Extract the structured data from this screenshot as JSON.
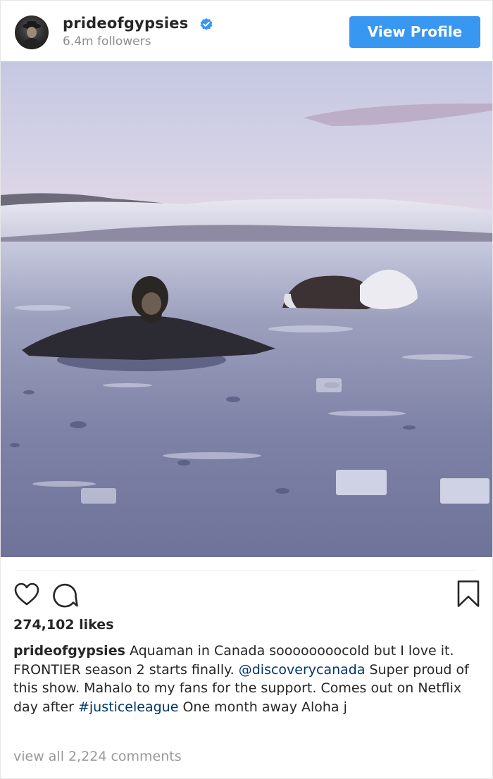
{
  "header": {
    "username": "prideofgypsies",
    "followers": "6.4m followers",
    "view_profile_label": "View Profile"
  },
  "icons": {
    "like": "heart-outline-icon",
    "comment": "speech-bubble-icon",
    "save": "bookmark-icon",
    "verified": "verified-badge-icon"
  },
  "colors": {
    "accent": "#3897f0",
    "link": "#003569",
    "muted": "#8e8e8e"
  },
  "post": {
    "likes": "274,102 likes",
    "caption_user": "prideofgypsies",
    "caption_part1": " Aquaman in Canada soooooooocold but I love it. FRONTIER season 2 starts finally. ",
    "caption_mention": "@discoverycanada",
    "caption_part2": " Super proud of this show. Mahalo to my fans for the support. Comes out on Netflix day after ",
    "caption_hashtag": "#justiceleague",
    "caption_part3": " One month away Aloha j",
    "view_comments": "view all 2,224 comments"
  }
}
